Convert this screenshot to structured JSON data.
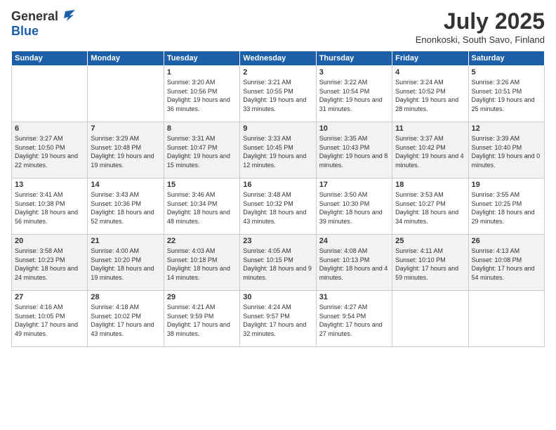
{
  "logo": {
    "general": "General",
    "blue": "Blue"
  },
  "header": {
    "title": "July 2025",
    "location": "Enonkoski, South Savo, Finland"
  },
  "days_of_week": [
    "Sunday",
    "Monday",
    "Tuesday",
    "Wednesday",
    "Thursday",
    "Friday",
    "Saturday"
  ],
  "weeks": [
    [
      {
        "day": "",
        "info": ""
      },
      {
        "day": "",
        "info": ""
      },
      {
        "day": "1",
        "info": "Sunrise: 3:20 AM\nSunset: 10:56 PM\nDaylight: 19 hours and 36 minutes."
      },
      {
        "day": "2",
        "info": "Sunrise: 3:21 AM\nSunset: 10:55 PM\nDaylight: 19 hours and 33 minutes."
      },
      {
        "day": "3",
        "info": "Sunrise: 3:22 AM\nSunset: 10:54 PM\nDaylight: 19 hours and 31 minutes."
      },
      {
        "day": "4",
        "info": "Sunrise: 3:24 AM\nSunset: 10:52 PM\nDaylight: 19 hours and 28 minutes."
      },
      {
        "day": "5",
        "info": "Sunrise: 3:26 AM\nSunset: 10:51 PM\nDaylight: 19 hours and 25 minutes."
      }
    ],
    [
      {
        "day": "6",
        "info": "Sunrise: 3:27 AM\nSunset: 10:50 PM\nDaylight: 19 hours and 22 minutes."
      },
      {
        "day": "7",
        "info": "Sunrise: 3:29 AM\nSunset: 10:48 PM\nDaylight: 19 hours and 19 minutes."
      },
      {
        "day": "8",
        "info": "Sunrise: 3:31 AM\nSunset: 10:47 PM\nDaylight: 19 hours and 15 minutes."
      },
      {
        "day": "9",
        "info": "Sunrise: 3:33 AM\nSunset: 10:45 PM\nDaylight: 19 hours and 12 minutes."
      },
      {
        "day": "10",
        "info": "Sunrise: 3:35 AM\nSunset: 10:43 PM\nDaylight: 19 hours and 8 minutes."
      },
      {
        "day": "11",
        "info": "Sunrise: 3:37 AM\nSunset: 10:42 PM\nDaylight: 19 hours and 4 minutes."
      },
      {
        "day": "12",
        "info": "Sunrise: 3:39 AM\nSunset: 10:40 PM\nDaylight: 19 hours and 0 minutes."
      }
    ],
    [
      {
        "day": "13",
        "info": "Sunrise: 3:41 AM\nSunset: 10:38 PM\nDaylight: 18 hours and 56 minutes."
      },
      {
        "day": "14",
        "info": "Sunrise: 3:43 AM\nSunset: 10:36 PM\nDaylight: 18 hours and 52 minutes."
      },
      {
        "day": "15",
        "info": "Sunrise: 3:46 AM\nSunset: 10:34 PM\nDaylight: 18 hours and 48 minutes."
      },
      {
        "day": "16",
        "info": "Sunrise: 3:48 AM\nSunset: 10:32 PM\nDaylight: 18 hours and 43 minutes."
      },
      {
        "day": "17",
        "info": "Sunrise: 3:50 AM\nSunset: 10:30 PM\nDaylight: 18 hours and 39 minutes."
      },
      {
        "day": "18",
        "info": "Sunrise: 3:53 AM\nSunset: 10:27 PM\nDaylight: 18 hours and 34 minutes."
      },
      {
        "day": "19",
        "info": "Sunrise: 3:55 AM\nSunset: 10:25 PM\nDaylight: 18 hours and 29 minutes."
      }
    ],
    [
      {
        "day": "20",
        "info": "Sunrise: 3:58 AM\nSunset: 10:23 PM\nDaylight: 18 hours and 24 minutes."
      },
      {
        "day": "21",
        "info": "Sunrise: 4:00 AM\nSunset: 10:20 PM\nDaylight: 18 hours and 19 minutes."
      },
      {
        "day": "22",
        "info": "Sunrise: 4:03 AM\nSunset: 10:18 PM\nDaylight: 18 hours and 14 minutes."
      },
      {
        "day": "23",
        "info": "Sunrise: 4:05 AM\nSunset: 10:15 PM\nDaylight: 18 hours and 9 minutes."
      },
      {
        "day": "24",
        "info": "Sunrise: 4:08 AM\nSunset: 10:13 PM\nDaylight: 18 hours and 4 minutes."
      },
      {
        "day": "25",
        "info": "Sunrise: 4:11 AM\nSunset: 10:10 PM\nDaylight: 17 hours and 59 minutes."
      },
      {
        "day": "26",
        "info": "Sunrise: 4:13 AM\nSunset: 10:08 PM\nDaylight: 17 hours and 54 minutes."
      }
    ],
    [
      {
        "day": "27",
        "info": "Sunrise: 4:16 AM\nSunset: 10:05 PM\nDaylight: 17 hours and 49 minutes."
      },
      {
        "day": "28",
        "info": "Sunrise: 4:18 AM\nSunset: 10:02 PM\nDaylight: 17 hours and 43 minutes."
      },
      {
        "day": "29",
        "info": "Sunrise: 4:21 AM\nSunset: 9:59 PM\nDaylight: 17 hours and 38 minutes."
      },
      {
        "day": "30",
        "info": "Sunrise: 4:24 AM\nSunset: 9:57 PM\nDaylight: 17 hours and 32 minutes."
      },
      {
        "day": "31",
        "info": "Sunrise: 4:27 AM\nSunset: 9:54 PM\nDaylight: 17 hours and 27 minutes."
      },
      {
        "day": "",
        "info": ""
      },
      {
        "day": "",
        "info": ""
      }
    ]
  ]
}
